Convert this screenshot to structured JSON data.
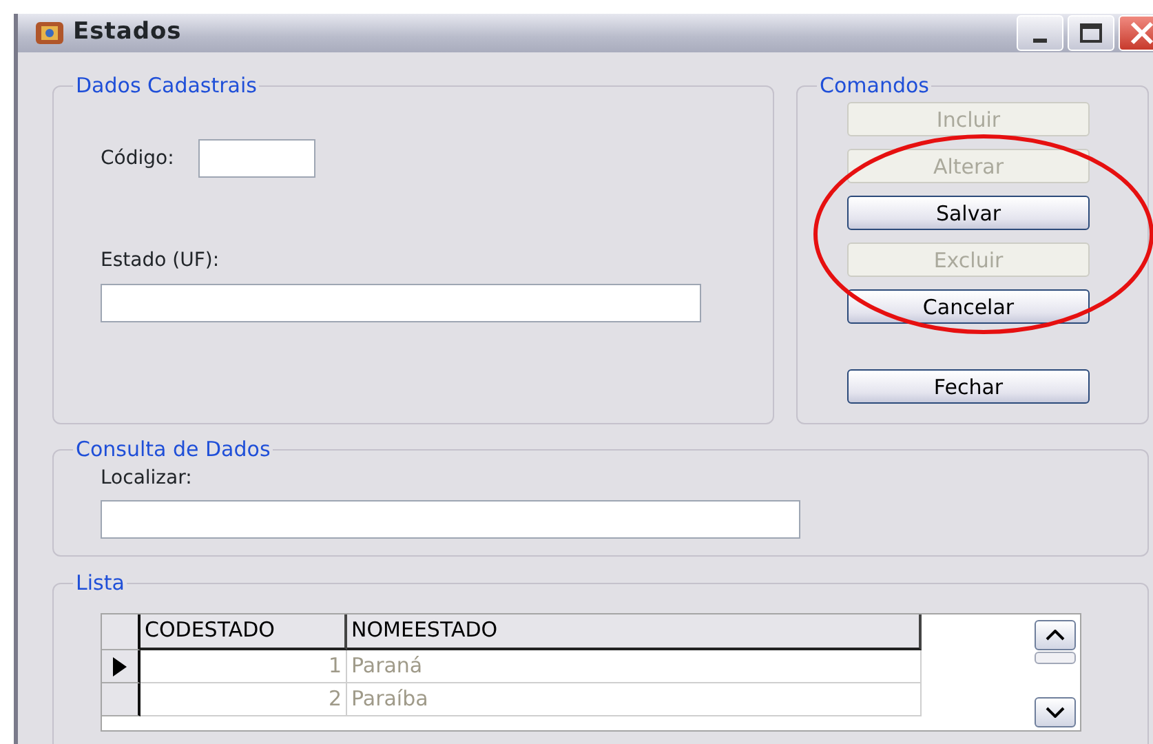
{
  "window": {
    "title": "Estados"
  },
  "dados_cadastrais": {
    "title": "Dados Cadastrais",
    "fields": [
      {
        "label": "Código:",
        "kind": "short"
      },
      {
        "label": "Estado (UF):",
        "kind": "long"
      }
    ]
  },
  "comandos": {
    "title": "Comandos",
    "buttons": [
      {
        "label": "Incluir",
        "disabled": true
      },
      {
        "label": "Alterar",
        "disabled": true
      },
      {
        "label": "Salvar",
        "disabled": false
      },
      {
        "label": "Excluir",
        "disabled": true
      },
      {
        "label": "Cancelar",
        "disabled": false
      },
      {
        "label": "Fechar",
        "disabled": false
      }
    ]
  },
  "consulta": {
    "title": "Consulta de Dados",
    "label": "Localizar:"
  },
  "lista": {
    "title": "Lista",
    "columns": [
      "CODESTADO",
      "NOMEESTADO"
    ],
    "rows": [
      {
        "cells": [
          "1",
          "Paraná"
        ],
        "selected": true
      },
      {
        "cells": [
          "2",
          "Paraíba"
        ],
        "selected": false
      }
    ]
  }
}
